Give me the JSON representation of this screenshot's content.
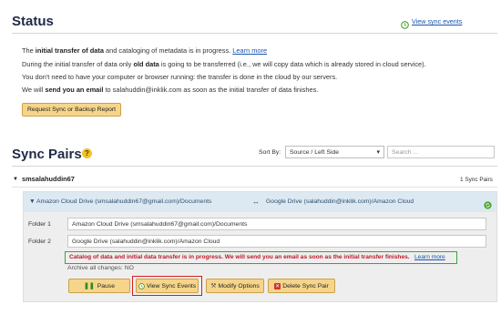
{
  "status": {
    "title": "Status",
    "view_sync_events": "View sync events",
    "lines": {
      "l1_a": "The ",
      "l1_b": "initial transfer of data",
      "l1_c": " and cataloging of metadata is in progress. ",
      "l1_link": "Learn more",
      "l2_a": "During the initial transfer of data only ",
      "l2_b": "old data",
      "l2_c": " is going to be transferred (i.e., we will copy data which is already stored in cloud service).",
      "l3": "You don't need to have your computer or browser running: the transfer is done in the cloud by our servers.",
      "l4_a": "We will ",
      "l4_b": "send you an email",
      "l4_c": " to salahuddin@inklik.com as soon as the initial transfer of data finishes."
    },
    "report_button": "Request Sync or Backup Report"
  },
  "sync_pairs": {
    "title": "Sync Pairs",
    "help": "?",
    "sort_by_label": "Sort By:",
    "sort_value": "Source / Left Side",
    "search_placeholder": "Search ...",
    "group": {
      "name": "smsalahuddin67",
      "count": "1 Sync Pairs",
      "pair": {
        "left_header": "Amazon Cloud Drive (smsalahuddin67@gmail.com)/Documents",
        "right_header": "Google Drive (salahuddin@inklik.com)/Amazon Cloud",
        "folder1_label": "Folder 1",
        "folder1_value": "Amazon Cloud Drive (smsalahuddin67@gmail.com)/Documents",
        "folder2_label": "Folder 2",
        "folder2_value": "Google Drive (salahuddin@inklik.com)/Amazon Cloud",
        "message": "Catalog of data and initial data transfer is in progress. We will send you an email as soon as the initial transfer finishes.",
        "message_link": "Learn more",
        "archive_text": "Archive all changes: NO",
        "buttons": {
          "pause": "Pause",
          "view_events": "View Sync Events",
          "modify": "Modify Options",
          "delete": "Delete Sync Pair"
        }
      }
    }
  },
  "colors": {
    "accent_orange": "#f6d58a",
    "highlight_green": "#3aa53a",
    "highlight_red": "#d42020",
    "warning_red": "#c0182b"
  }
}
